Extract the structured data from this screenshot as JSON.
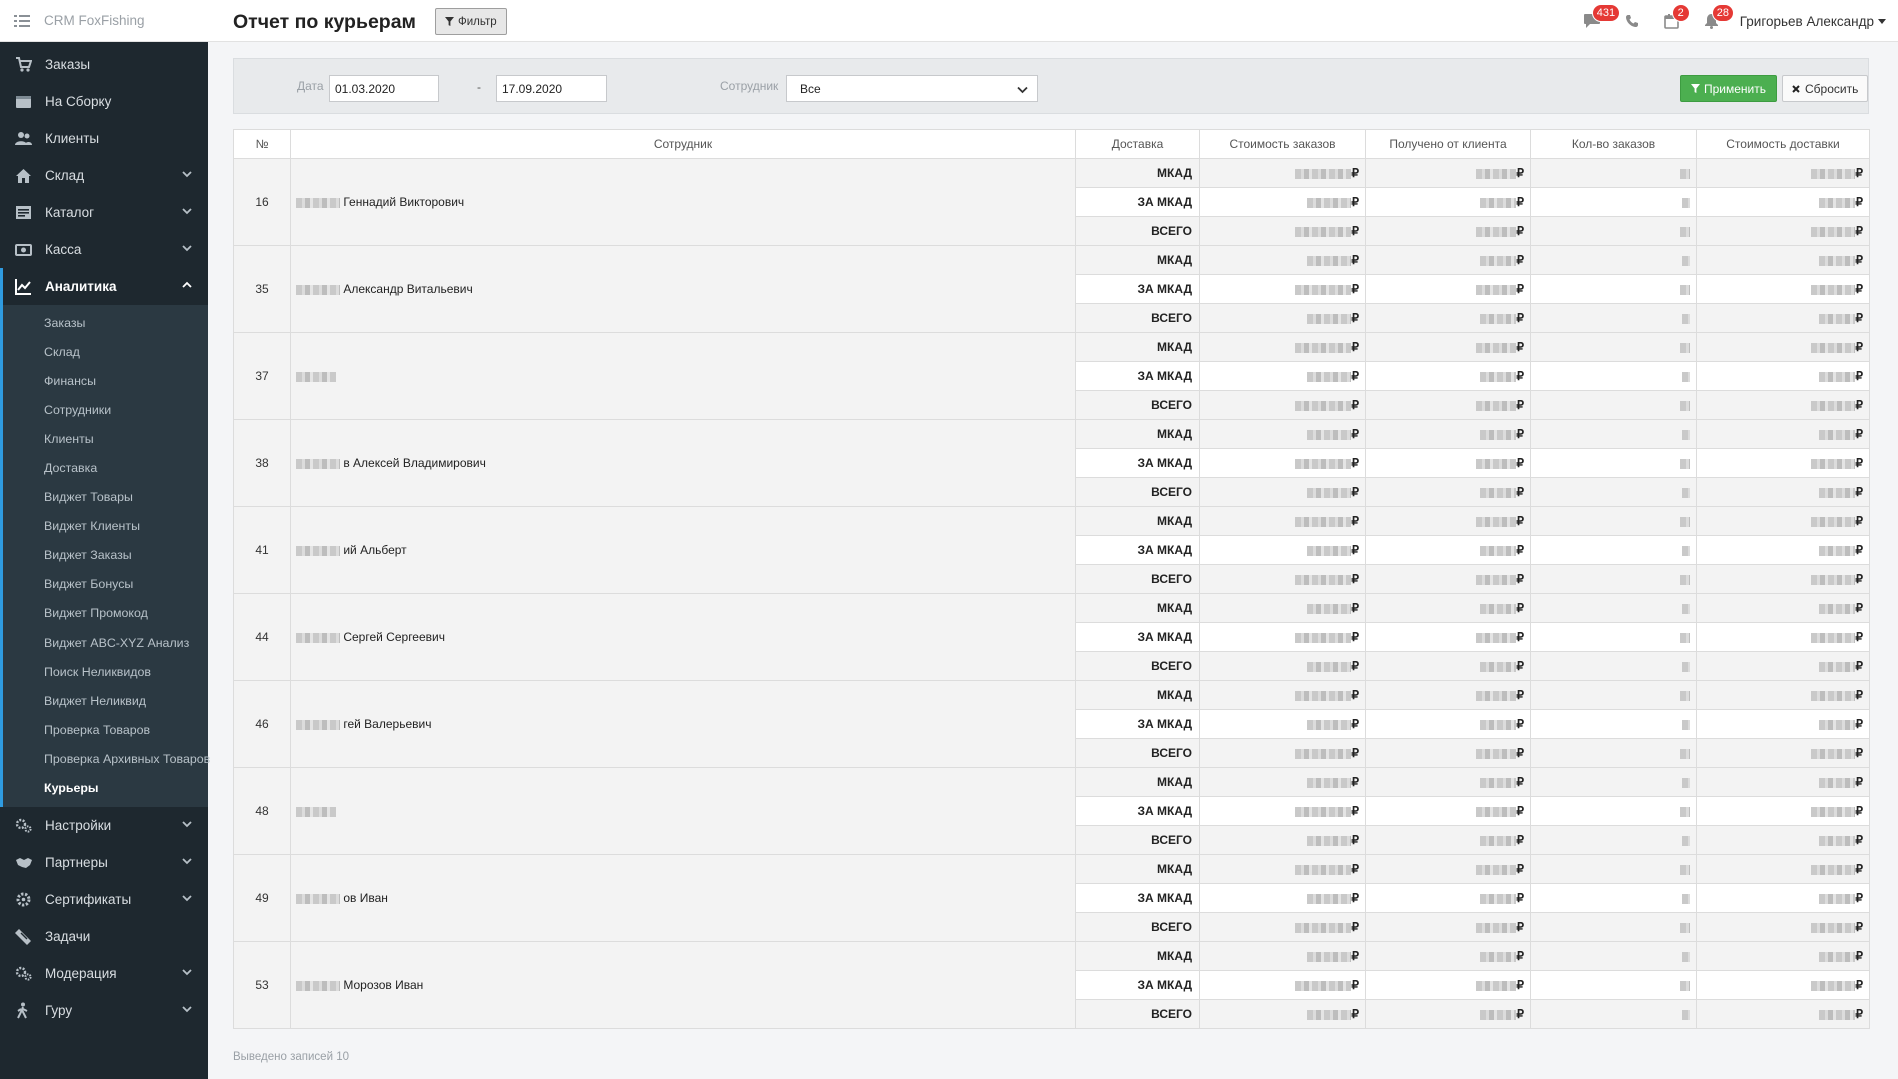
{
  "brand": {
    "name": "CRM FoxFishing",
    "icon": "list-icon"
  },
  "sidebar": {
    "items": [
      {
        "label": "Заказы",
        "icon": "cart-icon",
        "chevron": false
      },
      {
        "label": "На Сборку",
        "icon": "inbox-icon",
        "chevron": false
      },
      {
        "label": "Клиенты",
        "icon": "users-icon",
        "chevron": false
      },
      {
        "label": "Склад",
        "icon": "home-icon",
        "chevron": true
      },
      {
        "label": "Каталог",
        "icon": "catalog-icon",
        "chevron": true
      },
      {
        "label": "Касса",
        "icon": "money-icon",
        "chevron": true
      },
      {
        "label": "Аналитика",
        "icon": "chart-icon",
        "chevron": true,
        "active": true
      }
    ],
    "analytics_sub": [
      "Заказы",
      "Склад",
      "Финансы",
      "Сотрудники",
      "Клиенты",
      "Доставка",
      "Виджет Товары",
      "Виджет Клиенты",
      "Виджет Заказы",
      "Виджет Бонусы",
      "Виджет Промокод",
      "Виджет ABC-XYZ Анализ",
      "Поиск Неликвидов",
      "Виджет Неликвид",
      "Проверка Товаров",
      "Проверка Архивных Товаров",
      "Курьеры"
    ],
    "current_sub": "Курьеры",
    "items_after": [
      {
        "label": "Настройки",
        "icon": "cogs-icon",
        "chevron": true
      },
      {
        "label": "Партнеры",
        "icon": "handshake-icon",
        "chevron": true
      },
      {
        "label": "Сертификаты",
        "icon": "gear-icon",
        "chevron": true
      },
      {
        "label": "Задачи",
        "icon": "ticket-icon",
        "chevron": false
      },
      {
        "label": "Модерация",
        "icon": "cogs-icon",
        "chevron": true
      },
      {
        "label": "Гуру",
        "icon": "walker-icon",
        "chevron": true
      }
    ]
  },
  "header": {
    "title": "Отчет по курьерам",
    "filter_button": "Фильтр",
    "badges": {
      "messages": "431",
      "orders": "2",
      "notifications": "28"
    },
    "user": "Григорьев Александр"
  },
  "filter": {
    "date_label": "Дата",
    "date_from": "01.03.2020",
    "date_sep": "-",
    "date_to": "17.09.2020",
    "employee_label": "Сотрудник",
    "employee_value": "Все",
    "apply": "Применить",
    "reset": "Сбросить"
  },
  "table": {
    "columns": [
      "№",
      "Сотрудник",
      "Доставка",
      "Стоимость заказов",
      "Получено от клиента",
      "Кол-во заказов",
      "Стоимость доставки"
    ],
    "delivery_types": [
      "МКАД",
      "ЗА МКАД",
      "ВСЕГО"
    ],
    "currency": "₽",
    "rows": [
      {
        "id": "16",
        "name": "Геннадий Викторович"
      },
      {
        "id": "35",
        "name": "Александр Витальевич"
      },
      {
        "id": "37",
        "name": ""
      },
      {
        "id": "38",
        "name": "в Алексей Владимирович"
      },
      {
        "id": "41",
        "name": "ий Альберт"
      },
      {
        "id": "44",
        "name": "Сергей Сергеевич"
      },
      {
        "id": "46",
        "name": "гей Валерьевич"
      },
      {
        "id": "48",
        "name": ""
      },
      {
        "id": "49",
        "name": "ов Иван"
      },
      {
        "id": "53",
        "name": "Морозов Иван"
      }
    ]
  },
  "footer": {
    "records": "Выведено записей 10"
  },
  "colors": {
    "sidebar_bg": "#1e282f",
    "accent": "#2f9be0",
    "apply": "#4caf50",
    "badge": "#e53935"
  }
}
